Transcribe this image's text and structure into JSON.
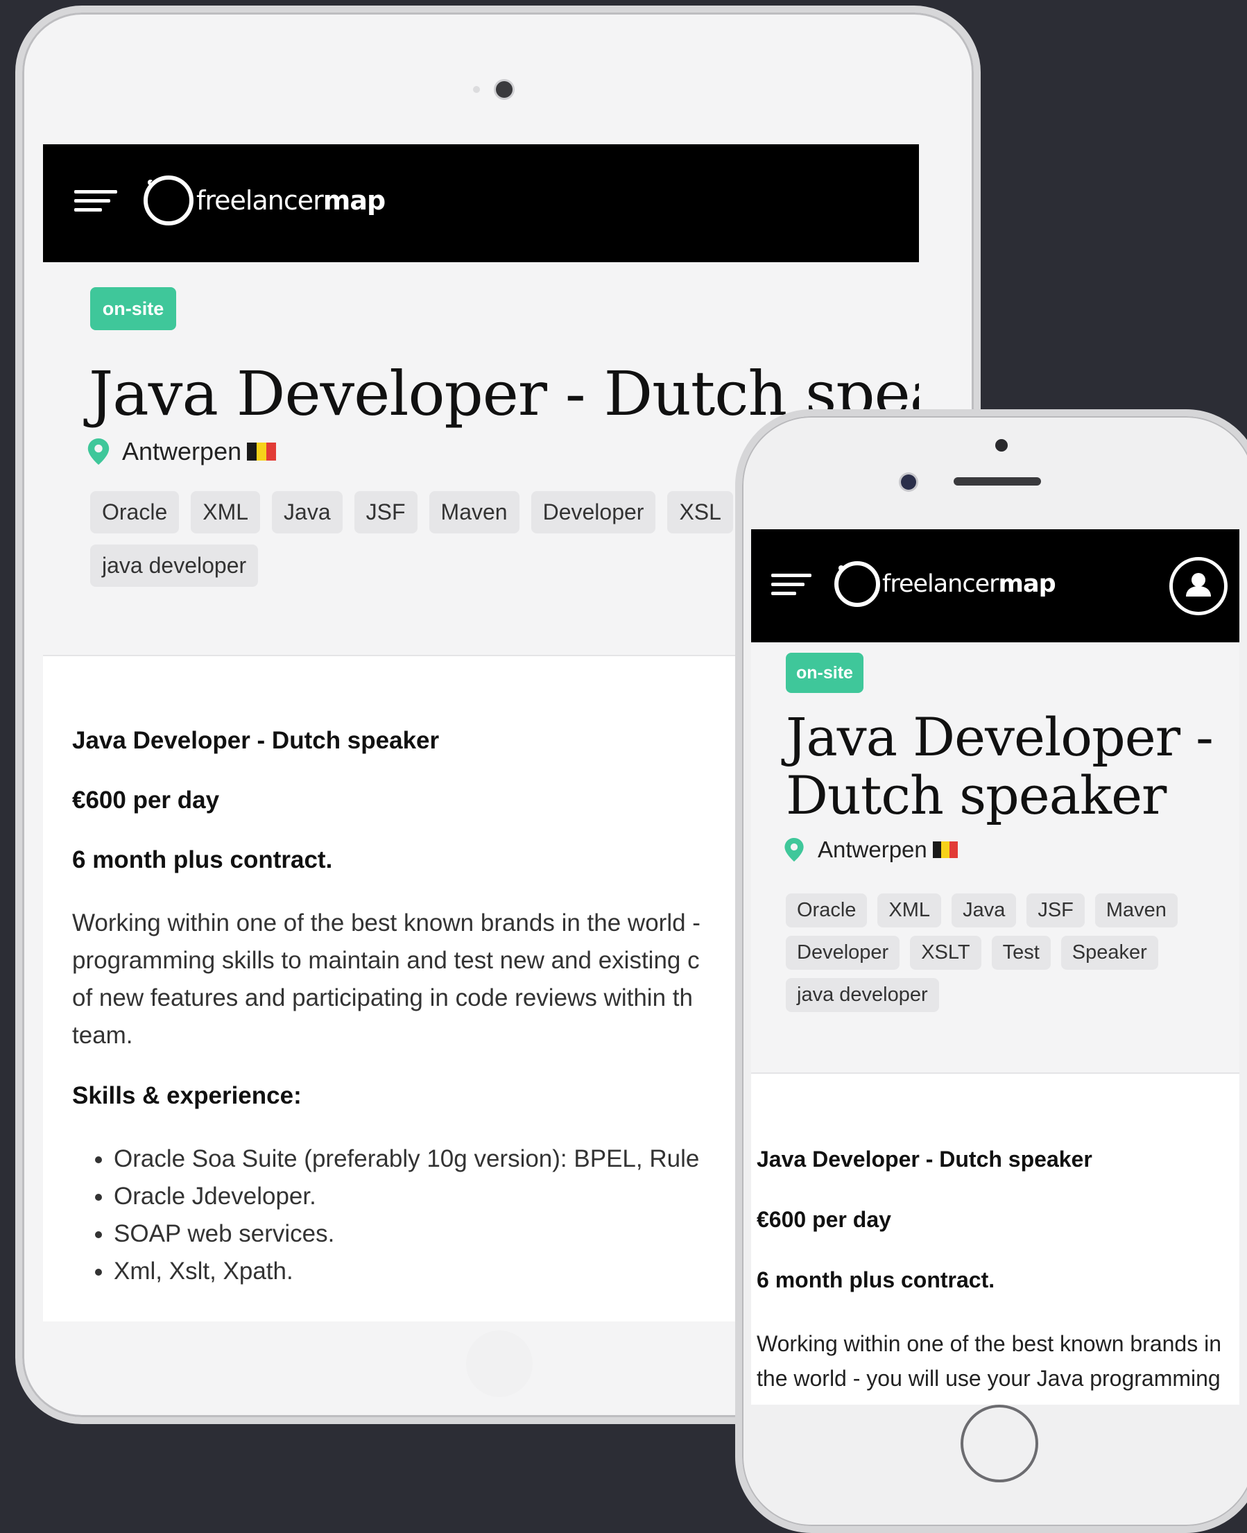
{
  "logo_text_light": "freelancer",
  "logo_text_bold": "map",
  "badge": "on-site",
  "job_title": "Java Developer - Dutch speaker",
  "job_title_line1": "Java Developer -",
  "job_title_line2": "Dutch speaker",
  "tablet_title_visible": "Java Developer - Dutch speal",
  "location": "Antwerpen",
  "tablet_tags_row1": [
    "Oracle",
    "XML",
    "Java",
    "JSF",
    "Maven",
    "Developer",
    "XSL"
  ],
  "tablet_tags_row2": [
    "java developer"
  ],
  "phone_tags": [
    "Oracle",
    "XML",
    "Java",
    "JSF",
    "Maven",
    "Developer",
    "XSLT",
    "Test",
    "Speaker",
    "java developer"
  ],
  "body_heading": "Java Developer - Dutch speaker",
  "rate": "€600 per day",
  "contract": "6 month plus contract.",
  "tablet_desc_lines": [
    "Working within one of the best known brands in the world -",
    "programming skills to maintain and test new and existing c",
    "of new features and participating in code reviews within th",
    "team."
  ],
  "skills_heading": "Skills & experience:",
  "skills": [
    "Oracle Soa Suite (preferably 10g version): BPEL, Rule",
    "Oracle Jdeveloper.",
    "SOAP web services.",
    "Xml, Xslt, Xpath."
  ],
  "phone_desc_lines": [
    "Working within one of the best known brands in",
    "the world - you will use your Java programming"
  ],
  "colors": {
    "badge": "#3fc79a",
    "pin": "#3fc79a",
    "flag_black": "#1a1a1a",
    "flag_yellow": "#f6d21a",
    "flag_red": "#e23b36"
  }
}
